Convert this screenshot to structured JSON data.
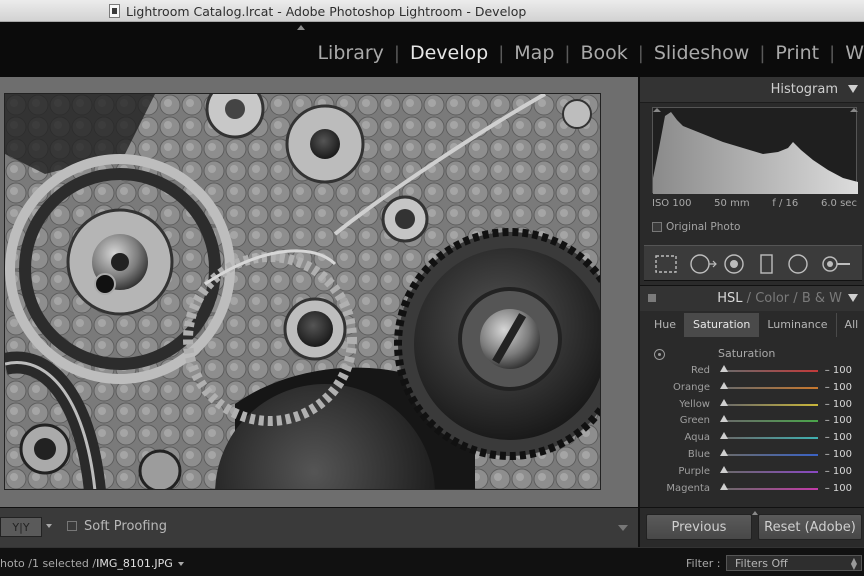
{
  "window": {
    "title": "Lightroom Catalog.lrcat - Adobe Photoshop Lightroom - Develop"
  },
  "modules": {
    "items": [
      "Library",
      "Develop",
      "Map",
      "Book",
      "Slideshow",
      "Print",
      "W"
    ],
    "active": "Develop",
    "separator": "|"
  },
  "histogram": {
    "panel_label": "Histogram",
    "iso": "ISO 100",
    "focal": "50 mm",
    "aperture": "f / 16",
    "shutter": "6.0 sec",
    "original_photo_label": "Original Photo"
  },
  "hsl": {
    "labels": [
      "HSL",
      "Color",
      "B & W"
    ],
    "label_sep": "/",
    "tabs": [
      "Hue",
      "Saturation",
      "Luminance",
      "All"
    ],
    "active_tab": "Saturation",
    "section_title": "Saturation",
    "sliders": [
      {
        "name": "Red",
        "value": "– 100",
        "color": "#c23a3a",
        "level": 0
      },
      {
        "name": "Orange",
        "value": "– 100",
        "color": "#c8782e",
        "level": 0
      },
      {
        "name": "Yellow",
        "value": "– 100",
        "color": "#c9b63a",
        "level": 0
      },
      {
        "name": "Green",
        "value": "– 100",
        "color": "#4aa54a",
        "level": 0
      },
      {
        "name": "Aqua",
        "value": "– 100",
        "color": "#3fb0b0",
        "level": 0
      },
      {
        "name": "Blue",
        "value": "– 100",
        "color": "#3a62c4",
        "level": 0
      },
      {
        "name": "Purple",
        "value": "– 100",
        "color": "#8a48c2",
        "level": 0
      },
      {
        "name": "Magenta",
        "value": "– 100",
        "color": "#c23aa8",
        "level": 0
      }
    ]
  },
  "toolbar": {
    "yy_label": "Y|Y",
    "soft_proofing_label": "Soft Proofing"
  },
  "buttons": {
    "previous": "Previous",
    "reset": "Reset (Adobe)"
  },
  "filmstrip": {
    "source_prefix": "hoto /1 selected /",
    "file_name": "IMG_8101.JPG",
    "filter_label": "Filter :",
    "filter_value": "Filters Off"
  }
}
